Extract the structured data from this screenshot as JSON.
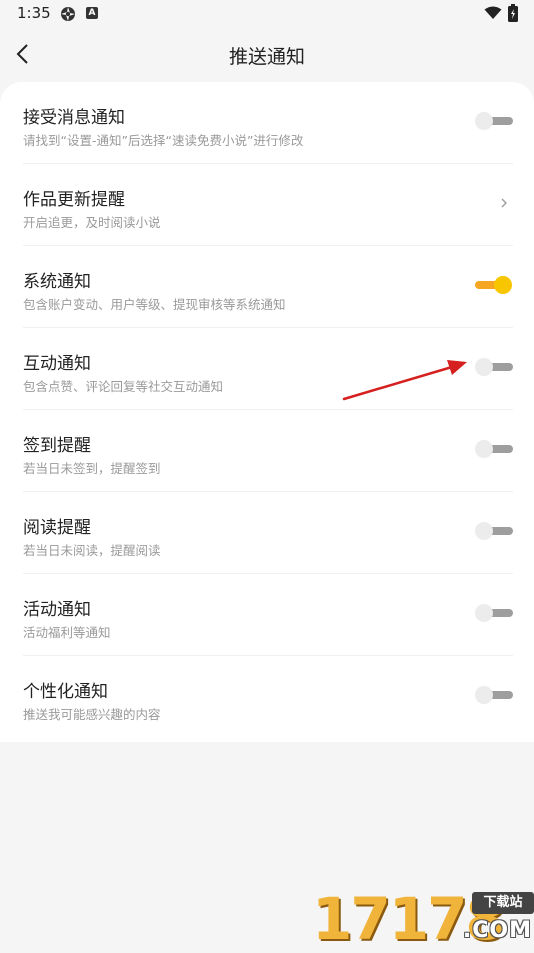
{
  "status_bar": {
    "time": "1:35",
    "icons": [
      "shutter-icon",
      "a-icon",
      "wifi-icon",
      "battery-icon"
    ]
  },
  "header": {
    "title": "推送通知",
    "back_icon": "chevron-left-icon"
  },
  "settings": [
    {
      "title": "接受消息通知",
      "subtitle": "请找到“设置-通知”后选择“速读免费小说”进行修改",
      "control": "toggle",
      "on": false
    },
    {
      "title": "作品更新提醒",
      "subtitle": "开启追更，及时阅读小说",
      "control": "chevron"
    },
    {
      "title": "系统通知",
      "subtitle": "包含账户变动、用户等级、提现审核等系统通知",
      "control": "toggle",
      "on": true
    },
    {
      "title": "互动通知",
      "subtitle": "包含点赞、评论回复等社交互动通知",
      "control": "toggle",
      "on": false
    },
    {
      "title": "签到提醒",
      "subtitle": "若当日未签到，提醒签到",
      "control": "toggle",
      "on": false
    },
    {
      "title": "阅读提醒",
      "subtitle": "若当日未阅读，提醒阅读",
      "control": "toggle",
      "on": false
    },
    {
      "title": "活动通知",
      "subtitle": "活动福利等通知",
      "control": "toggle",
      "on": false
    },
    {
      "title": "个性化通知",
      "subtitle": "推送我可能感兴趣的内容",
      "control": "toggle",
      "on": false
    }
  ],
  "colors": {
    "toggle_on_knob": "#f7c600",
    "toggle_on_track": "#f5a623",
    "toggle_off_track": "#9e9e9e",
    "annotation_arrow": "#d62020"
  },
  "watermark": {
    "digits": "17178",
    "badge": "下载站",
    "suffix": ".COM"
  }
}
